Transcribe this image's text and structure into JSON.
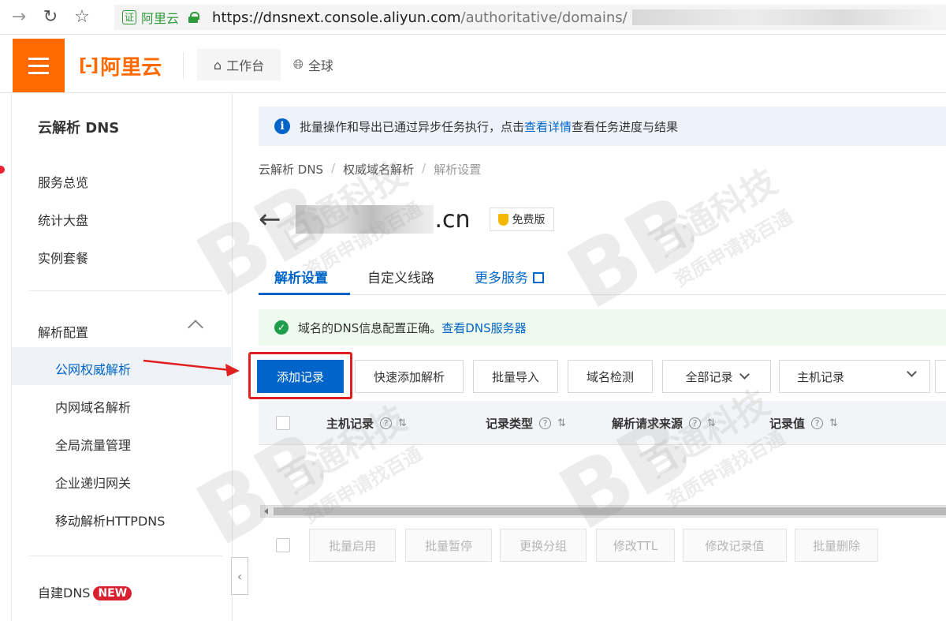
{
  "browser": {
    "url_host": "https://dnsnext.console.aliyun.com",
    "url_path": "/authoritative/domains/",
    "cert_label": "阿里云",
    "cert_box": "证"
  },
  "header": {
    "logo_text": "阿里云",
    "logo_mark": "[-]",
    "workbench": "工作台",
    "global": "全球"
  },
  "sidebar": {
    "title": "云解析 DNS",
    "items": [
      "服务总览",
      "统计大盘",
      "实例套餐"
    ],
    "section": "解析配置",
    "sub_items": [
      "公网权威解析",
      "内网域名解析",
      "全局流量管理",
      "企业递归网关",
      "移动解析HTTPDNS"
    ],
    "self_dns": "自建DNS",
    "new_badge": "NEW",
    "collapse": "‹"
  },
  "notice": {
    "text_before": "批量操作和导出已通过异步任务执行，点击",
    "link": "查看详情",
    "text_after": "查看任务进度与结果"
  },
  "breadcrumb": [
    "云解析 DNS",
    "权威域名解析",
    "解析设置"
  ],
  "domain": {
    "suffix": ".cn",
    "badge": "免费版"
  },
  "tabs": [
    "解析设置",
    "自定义线路",
    "更多服务"
  ],
  "success": {
    "text": "域名的DNS信息配置正确。",
    "link": "查看DNS服务器"
  },
  "toolbar": {
    "add_record": "添加记录",
    "quick_add": "快速添加解析",
    "batch_import": "批量导入",
    "domain_check": "域名检测",
    "all_records": "全部记录",
    "host_record": "主机记录"
  },
  "table": {
    "columns": [
      "主机记录",
      "记录类型",
      "解析请求来源",
      "记录值"
    ]
  },
  "batch": {
    "enable": "批量启用",
    "pause": "批量暂停",
    "change_group": "更换分组",
    "modify_ttl": "修改TTL",
    "modify_value": "修改记录值",
    "delete": "批量删除"
  },
  "watermark": {
    "brand": "百通科技",
    "slogan": "资质申请找百通",
    "logo": "BB"
  }
}
